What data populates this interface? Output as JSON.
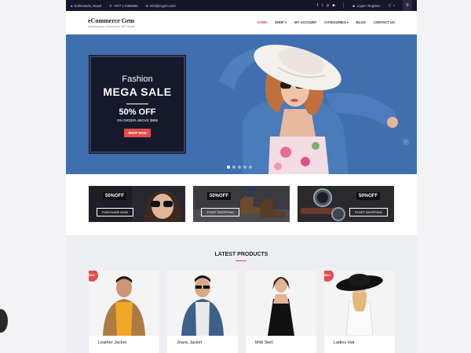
{
  "topbar": {
    "location": "Kathmandu, Nepal",
    "phone": "+977-1-5366655",
    "email": "info@ecgem.com",
    "social": [
      "f",
      "t",
      "p",
      "▶"
    ],
    "account": "Login / Register",
    "cart_count": "0"
  },
  "brand": {
    "title": "eCommerce Gem",
    "tagline": "Multipurpose eCommerce WP Theme"
  },
  "nav": [
    {
      "label": "HOME",
      "active": true,
      "dropdown": false
    },
    {
      "label": "SHOP",
      "active": false,
      "dropdown": true
    },
    {
      "label": "MY ACCOUNT",
      "active": false,
      "dropdown": false
    },
    {
      "label": "CATEGORIES",
      "active": false,
      "dropdown": true
    },
    {
      "label": "BLOG",
      "active": false,
      "dropdown": false
    },
    {
      "label": "CONTACT US",
      "active": false,
      "dropdown": false
    }
  ],
  "hero": {
    "kicker": "Fashion",
    "headline": "MEGA SALE",
    "offer": "50% OFF",
    "offer_sub": "ON ORDER ABOVE $999",
    "button": "SHOP NOW",
    "slide_count": 5,
    "active_slide": 1
  },
  "promos": [
    {
      "pct": "50%OFF",
      "button": "PURCHASE NOW"
    },
    {
      "pct": "50%OFF",
      "button": "START SHOPPING"
    },
    {
      "pct": "50%OFF",
      "button": "START SHOPPING"
    }
  ],
  "latest": {
    "title": "LATEST PRODUCTS",
    "products": [
      {
        "name": "Leather Jacket",
        "sale": "Sale!"
      },
      {
        "name": "Jeans Jacket",
        "sale": ""
      },
      {
        "name": "Midi Skirt",
        "sale": ""
      },
      {
        "name": "Ladies Hat",
        "sale": "Sale!"
      }
    ]
  },
  "colors": {
    "accent": "#e74c4c",
    "hero_bg": "#3f6fae",
    "dark": "#16182b"
  }
}
